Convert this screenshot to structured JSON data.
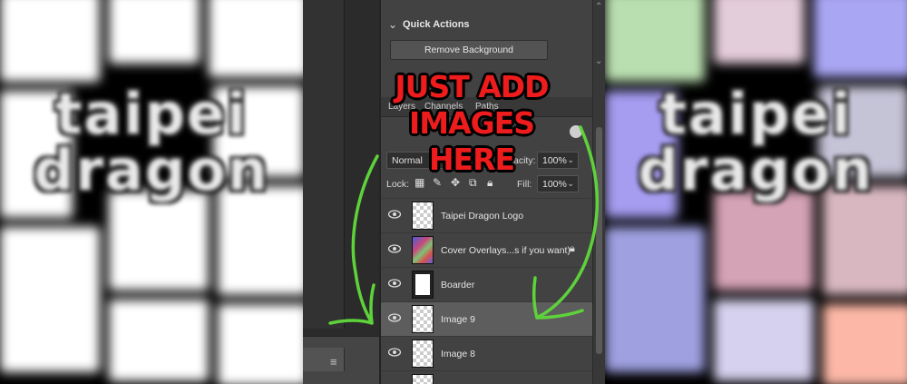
{
  "left_preview": {
    "logo_line1": "taipei",
    "logo_line2": "dragon"
  },
  "right_preview": {
    "logo_line1": "taipei",
    "logo_line2": "dragon",
    "tile_colors": [
      "#b9deb0",
      "#e4cdda",
      "#a9a6f4",
      "#a69cf0",
      "#c5c3d6",
      "#9ea0e0",
      "#d4a3b5",
      "#d8b7c0",
      "#d5d1ee",
      "#fcb7a6"
    ]
  },
  "quick_actions": {
    "title": "Quick Actions",
    "remove_background_label": "Remove Background"
  },
  "layers_panel": {
    "tabs": [
      "Layers",
      "Channels",
      "Paths"
    ],
    "blend_mode": "Normal",
    "opacity_label": "Opacity:",
    "opacity_value": "100%",
    "lock_label": "Lock:",
    "fill_label": "Fill:",
    "fill_value": "100%",
    "layers": [
      {
        "name": "Taipei Dragon Logo",
        "locked": false,
        "selected": false
      },
      {
        "name": "Cover Overlays...s if you want)",
        "locked": true,
        "selected": false
      },
      {
        "name": "Boarder",
        "locked": false,
        "selected": false
      },
      {
        "name": "Image 9",
        "locked": false,
        "selected": true
      },
      {
        "name": "Image 8",
        "locked": false,
        "selected": false
      }
    ]
  },
  "annotation": {
    "line1": "JUST ADD",
    "line2": "IMAGES HERE",
    "arrow_color": "#5ed23a"
  }
}
